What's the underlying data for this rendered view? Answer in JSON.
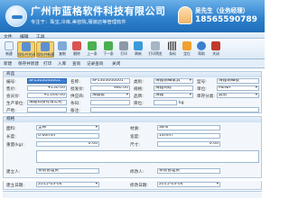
{
  "header": {
    "company": "广州市蓝格软件科技有限公司",
    "tagline": "专注于：珠宝,冷库,美容院,服装店等管理软件",
    "contact_name": "吴先生（业务经理）",
    "phone": "18565590789",
    "brand_color": "#2f82cf"
  },
  "menu": [
    "文件",
    "编辑",
    "工具"
  ],
  "toolbar": [
    "新建",
    "保存并关闭",
    "保存并新建",
    "复制",
    "删除",
    "上一条",
    "下一条",
    "打印",
    "刷新",
    "打印预览",
    "条码",
    "定位",
    "帮助",
    "关闭"
  ],
  "tabs": [
    "新建",
    "保存并新建",
    "打印",
    "入库",
    "查询",
    "记录查询",
    "关闭"
  ],
  "product": {
    "title": "商品",
    "labels": {
      "code": "编号:",
      "name": "名称:",
      "price": "售价:",
      "wholesale": "批发价:",
      "vip": "会员价:",
      "supplier": "供应商:",
      "origin": "产地:",
      "category": "类别:",
      "type": "型号:",
      "unit": "单位:",
      "barcode": "条码:",
      "spec": "规格:",
      "brand": "品牌:",
      "maker": "生产单位:",
      "location": "库位:",
      "remark": "备注:",
      "stock_cat": "库存分类:"
    },
    "values": {
      "code": "SP1303040001",
      "name": "SP1303040001",
      "price": "¥150.00",
      "wholesale": "980.00",
      "vip": "¥1,000.00",
      "supplier": "海鑫模",
      "origin": "海鑫科技有限公司",
      "category": "海鑫精细家具",
      "type": "海鑫精细板",
      "unit": "MENA",
      "spec": "海鑫商标",
      "brand": "海鑫",
      "stock_cat": "其他",
      "weight_unit": "kg"
    }
  },
  "specs": {
    "title": "规格",
    "labels": {
      "material": "面料:",
      "texture": "材质:",
      "length": "长度:",
      "width": "宽度:",
      "weight": "重量(kg):",
      "ratio": "占比:",
      "size": "尺寸:"
    },
    "values": {
      "material": "全棉",
      "texture": "38%",
      "length": "0.66mm",
      "width": "14mm",
      "weight": "0.00",
      "size": "0.00"
    }
  },
  "footer": {
    "labels": {
      "creator": "建立人:",
      "created": "建立日期:",
      "editor": "修改人:",
      "edited": "修改日期:"
    },
    "values": {
      "creator": "系统管理员",
      "created": "2015-03-04",
      "editor": "系统管理员",
      "edited": "2015-03-04"
    }
  }
}
